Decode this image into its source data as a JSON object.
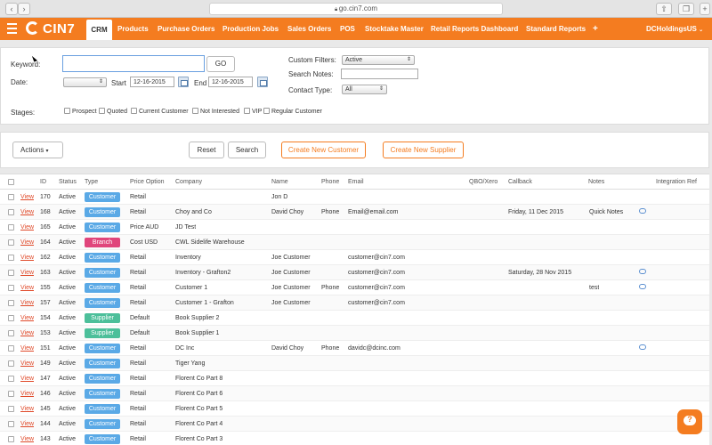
{
  "browser": {
    "url": "go.cin7.com",
    "back_icon": "chevron-left-icon",
    "forward_icon": "chevron-right-icon",
    "share_icon": "share-icon",
    "tabs_icon": "tabs-icon",
    "newtab_icon": "plus-icon"
  },
  "nav": {
    "logo": "CIN7",
    "menu_icon": "hamburger-icon",
    "active": "CRM",
    "items": [
      "Products",
      "Purchase Orders",
      "Production Jobs",
      "Sales Orders",
      "POS",
      "Stocktake Master",
      "Retail Reports Dashboard",
      "Standard Reports",
      "+"
    ],
    "account": "DCHoldingsUS",
    "brand_color": "#f47c20"
  },
  "filters": {
    "keyword_label": "Keyword:",
    "keyword_value": "",
    "go_label": "GO",
    "date_label": "Date:",
    "date_select": "",
    "start_label": "Start",
    "start_value": "12-16-2015",
    "end_label": "End",
    "end_value": "12-16-2015",
    "custom_filters_label": "Custom Filters:",
    "custom_filters_value": "Active",
    "search_notes_label": "Search Notes:",
    "search_notes_value": "",
    "contact_type_label": "Contact Type:",
    "contact_type_value": "All",
    "stages_label": "Stages:",
    "stages": [
      "Prospect",
      "Quoted",
      "Current Customer",
      "Not Interested",
      "VIP",
      "Regular Customer"
    ]
  },
  "toolbar": {
    "actions_label": "Actions",
    "reset_label": "Reset",
    "search_label": "Search",
    "create_customer_label": "Create New Customer",
    "create_supplier_label": "Create New Supplier"
  },
  "table": {
    "columns": [
      "ID",
      "Status",
      "Type",
      "Price Option",
      "Company",
      "Name",
      "Phone",
      "Email",
      "QBO/Xero",
      "Callback",
      "Notes",
      "Integration Ref"
    ],
    "view_label": "View",
    "type_colors": {
      "Customer": "#5aa9e6",
      "Branch": "#e0457b",
      "Supplier": "#4cbf9a"
    },
    "rows": [
      {
        "id": "170",
        "status": "Active",
        "type": "Customer",
        "price": "Retail",
        "company": "",
        "name": "Jon D",
        "phone": "",
        "email": "",
        "callback": "",
        "notes": "",
        "note_icon": false
      },
      {
        "id": "168",
        "status": "Active",
        "type": "Customer",
        "price": "Retail",
        "company": "Choy and Co",
        "name": "David Choy",
        "phone": "Phone",
        "email": "Email@email.com",
        "callback": "Friday, 11 Dec 2015",
        "notes": "Quick Notes",
        "note_icon": true
      },
      {
        "id": "165",
        "status": "Active",
        "type": "Customer",
        "price": "Price AUD",
        "company": "JD Test",
        "name": "",
        "phone": "",
        "email": "",
        "callback": "",
        "notes": "",
        "note_icon": false
      },
      {
        "id": "164",
        "status": "Active",
        "type": "Branch",
        "price": "Cost USD",
        "company": "CWL Sidelife Warehouse",
        "name": "",
        "phone": "",
        "email": "",
        "callback": "",
        "notes": "",
        "note_icon": false
      },
      {
        "id": "162",
        "status": "Active",
        "type": "Customer",
        "price": "Retail",
        "company": "Inventory",
        "name": "Joe Customer",
        "phone": "",
        "email": "customer@cin7.com",
        "callback": "",
        "notes": "",
        "note_icon": false
      },
      {
        "id": "163",
        "status": "Active",
        "type": "Customer",
        "price": "Retail",
        "company": "Inventory - Grafton2",
        "name": "Joe Customer",
        "phone": "",
        "email": "customer@cin7.com",
        "callback": "Saturday, 28 Nov 2015",
        "notes": "",
        "note_icon": true
      },
      {
        "id": "155",
        "status": "Active",
        "type": "Customer",
        "price": "Retail",
        "company": "Customer 1",
        "name": "Joe Customer",
        "phone": "Phone",
        "email": "customer@cin7.com",
        "callback": "",
        "notes": "test",
        "note_icon": true
      },
      {
        "id": "157",
        "status": "Active",
        "type": "Customer",
        "price": "Retail",
        "company": "Customer 1 - Grafton",
        "name": "Joe Customer",
        "phone": "",
        "email": "customer@cin7.com",
        "callback": "",
        "notes": "",
        "note_icon": false
      },
      {
        "id": "154",
        "status": "Active",
        "type": "Supplier",
        "price": "Default",
        "company": "Book Supplier 2",
        "name": "",
        "phone": "",
        "email": "",
        "callback": "",
        "notes": "",
        "note_icon": false
      },
      {
        "id": "153",
        "status": "Active",
        "type": "Supplier",
        "price": "Default",
        "company": "Book Supplier 1",
        "name": "",
        "phone": "",
        "email": "",
        "callback": "",
        "notes": "",
        "note_icon": false
      },
      {
        "id": "151",
        "status": "Active",
        "type": "Customer",
        "price": "Retail",
        "company": "DC Inc",
        "name": "David Choy",
        "phone": "Phone",
        "email": "davidc@dcinc.com",
        "callback": "",
        "notes": "",
        "note_icon": true
      },
      {
        "id": "149",
        "status": "Active",
        "type": "Customer",
        "price": "Retail",
        "company": "Tiger Yang",
        "name": "",
        "phone": "",
        "email": "",
        "callback": "",
        "notes": "",
        "note_icon": false
      },
      {
        "id": "147",
        "status": "Active",
        "type": "Customer",
        "price": "Retail",
        "company": "Florent Co Part 8",
        "name": "",
        "phone": "",
        "email": "",
        "callback": "",
        "notes": "",
        "note_icon": false
      },
      {
        "id": "146",
        "status": "Active",
        "type": "Customer",
        "price": "Retail",
        "company": "Florent Co Part 6",
        "name": "",
        "phone": "",
        "email": "",
        "callback": "",
        "notes": "",
        "note_icon": false
      },
      {
        "id": "145",
        "status": "Active",
        "type": "Customer",
        "price": "Retail",
        "company": "Florent Co Part 5",
        "name": "",
        "phone": "",
        "email": "",
        "callback": "",
        "notes": "",
        "note_icon": false
      },
      {
        "id": "144",
        "status": "Active",
        "type": "Customer",
        "price": "Retail",
        "company": "Florent Co Part 4",
        "name": "",
        "phone": "",
        "email": "",
        "callback": "",
        "notes": "",
        "note_icon": false
      },
      {
        "id": "143",
        "status": "Active",
        "type": "Customer",
        "price": "Retail",
        "company": "Florent Co Part 3",
        "name": "",
        "phone": "",
        "email": "",
        "callback": "",
        "notes": "",
        "note_icon": false
      }
    ]
  },
  "help_icon": "chat-help-icon"
}
